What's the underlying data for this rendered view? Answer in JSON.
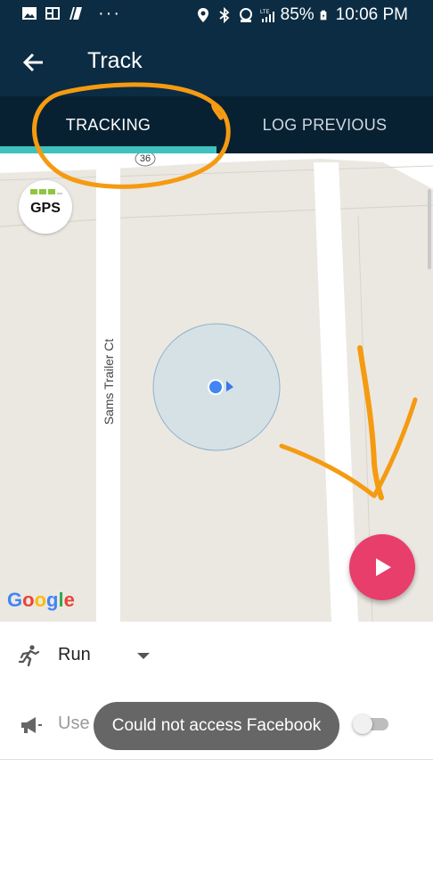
{
  "status_bar": {
    "battery": "85%",
    "time": "10:06 PM",
    "left_icons": [
      "image-icon",
      "photo-collage-icon",
      "flipboard-icon",
      "more-dots-icon"
    ],
    "right_icons": [
      "location-icon",
      "bluetooth-icon",
      "data-saver-icon",
      "lte-signal-icon",
      "battery-icon"
    ]
  },
  "appbar": {
    "title": "Track",
    "back_icon": "arrow-left-icon"
  },
  "tabs": [
    {
      "label": "TRACKING",
      "selected": true
    },
    {
      "label": "LOG PREVIOUS",
      "selected": false
    }
  ],
  "colors": {
    "header": "#0b2c42",
    "tabs": "#072133",
    "tab_indicator": "#3fc1c0",
    "fab": "#e83e6c",
    "annotation": "#f59b11",
    "map_bg": "#ebe8e2"
  },
  "map": {
    "road_label": "Sams Trailer Ct",
    "highway_shield": "36",
    "gps_label": "GPS",
    "gps_signal_bars": 3,
    "attribution": "Google",
    "play_icon": "play-icon"
  },
  "activity": {
    "label": "Run",
    "icon": "runner-icon"
  },
  "voice": {
    "label": "Use voice cues",
    "icon": "megaphone-icon",
    "enabled": false
  },
  "toast": {
    "message": "Could not access Facebook"
  }
}
